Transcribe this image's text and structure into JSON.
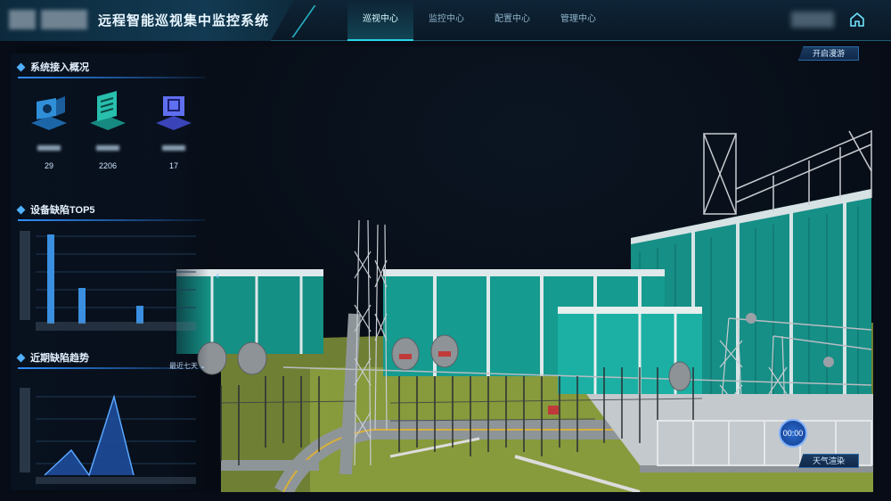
{
  "header": {
    "title": "远程智能巡视集中监控系统",
    "nav": [
      {
        "label": "巡视中心",
        "active": true
      },
      {
        "label": "监控中心",
        "active": false
      },
      {
        "label": "配置中心",
        "active": false
      },
      {
        "label": "管理中心",
        "active": false
      }
    ],
    "home_icon": "home-icon"
  },
  "left_panel": {
    "access_title": "系统接入概况",
    "stats": [
      {
        "icon": "camera-icon",
        "value": "29"
      },
      {
        "icon": "server-icon",
        "value": "2206"
      },
      {
        "icon": "robot-icon",
        "value": "17"
      }
    ],
    "defect_top_title": "设备缺陷TOP5",
    "defect_trend_title": "近期缺陷趋势",
    "range_label": "最近七天"
  },
  "scene": {
    "tour_button": "开启漫游",
    "weather_button": "天气渲染",
    "time": "00:00"
  },
  "colors": {
    "accent": "#26d6e8",
    "panel_title": "#4fb0ff",
    "building": "#1aa89a",
    "ground": "#8d9b3e"
  }
}
